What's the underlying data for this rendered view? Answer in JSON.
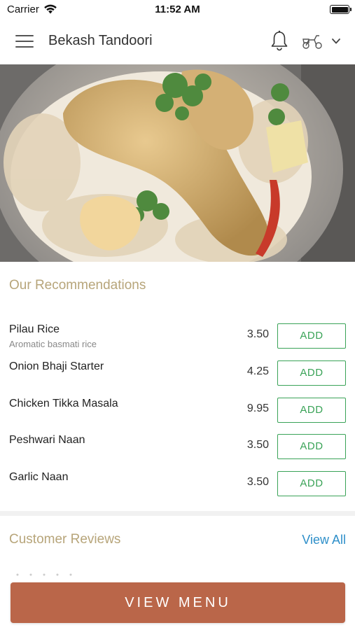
{
  "status_bar": {
    "carrier": "Carrier",
    "time": "11:52 AM"
  },
  "header": {
    "title": "Bekash Tandoori",
    "icons": [
      "menu-icon",
      "bell-icon",
      "scooter-icon",
      "chevron-down-icon"
    ]
  },
  "hero": {
    "image": "food-photo-chicken-leg-with-pilau-rice"
  },
  "recommendations": {
    "title": "Our Recommendations",
    "items": [
      {
        "name": "Pilau Rice",
        "description": "Aromatic basmati rice",
        "price": "3.50",
        "button": "ADD"
      },
      {
        "name": "Onion Bhaji Starter",
        "description": "",
        "price": "4.25",
        "button": "ADD"
      },
      {
        "name": "Chicken Tikka Masala",
        "description": "",
        "price": "9.95",
        "button": "ADD"
      },
      {
        "name": "Peshwari Naan",
        "description": "",
        "price": "3.50",
        "button": "ADD"
      },
      {
        "name": "Garlic Naan",
        "description": "",
        "price": "3.50",
        "button": "ADD"
      }
    ]
  },
  "reviews": {
    "title": "Customer Reviews",
    "view_all": "View All"
  },
  "footer": {
    "view_menu": "VIEW MENU"
  },
  "colors": {
    "accent_gold": "#b7a57a",
    "add_green": "#3aa357",
    "link_blue": "#2e8fc9",
    "cta_terracotta": "#ba6649"
  }
}
